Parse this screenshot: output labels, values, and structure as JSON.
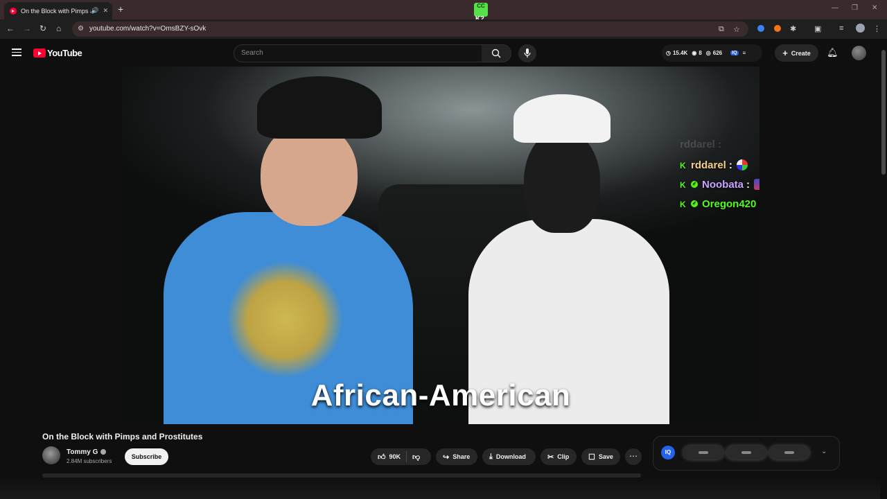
{
  "browser": {
    "tab_title": "On the Block with Pimps an",
    "url": "youtube.com/watch?v=OmsBZY-sOvk",
    "extension_label_top": "CC",
    "extension_label_bottom": "K2"
  },
  "youtube": {
    "logo_text": "YouTube",
    "search_placeholder": "Search",
    "stats": {
      "views": "15.4K",
      "viewers": "8",
      "watching": "626"
    },
    "create_label": "Create"
  },
  "video": {
    "caption": "African-American",
    "chat": [
      {
        "user": "rddarel",
        "color": "#f5d08a",
        "verified": false,
        "content_type": "emote"
      },
      {
        "user": "Noobata",
        "color": "#c9a3ff",
        "verified": true,
        "content_type": "emote"
      },
      {
        "user": "Oregon420",
        "color": "#53fc18",
        "verified": true,
        "content_type": "hearts"
      }
    ],
    "chat_ghost": "rddarel :"
  },
  "meta": {
    "title": "On the Block with Pimps and Prostitutes",
    "channel": "Tommy G",
    "subscribers": "2.84M subscribers",
    "subscribe_label": "Subscribe",
    "likes": "90K",
    "share_label": "Share",
    "download_label": "Download",
    "clip_label": "Clip",
    "save_label": "Save"
  },
  "side_panel": {
    "logo": "IQ"
  },
  "colors": {
    "accent": "#ff0033",
    "kick_green": "#53fc18"
  }
}
